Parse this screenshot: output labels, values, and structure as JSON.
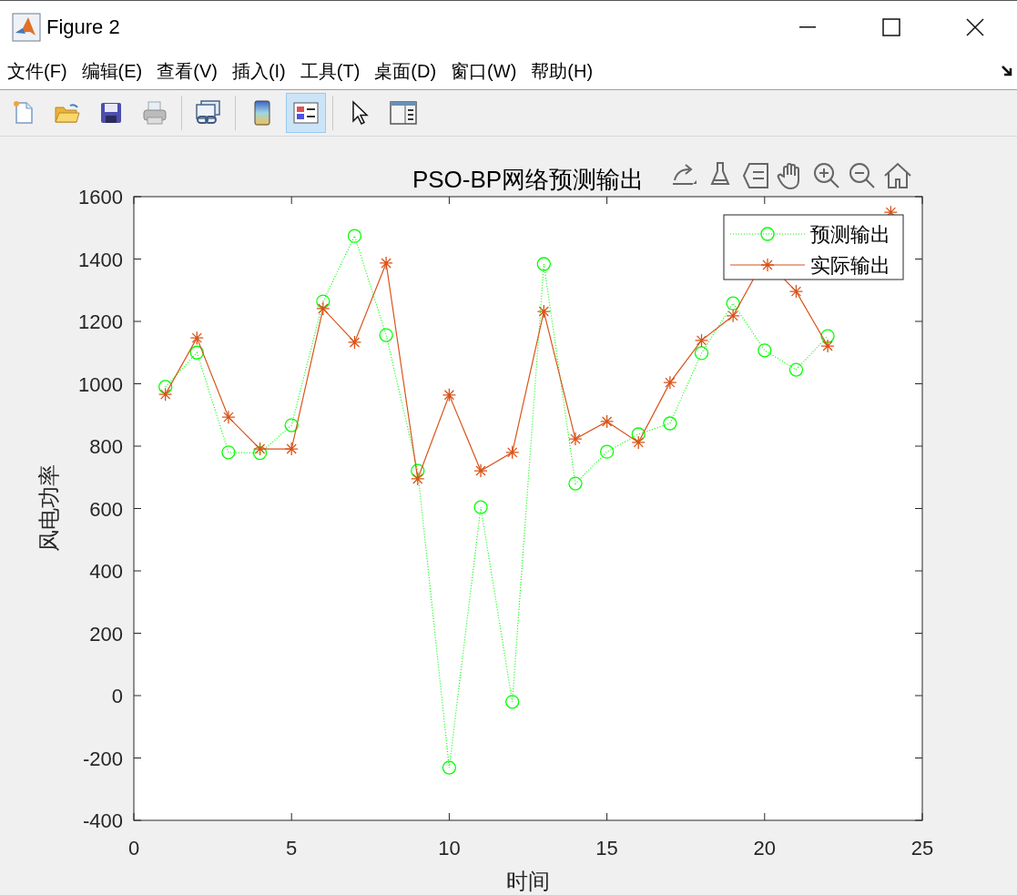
{
  "window": {
    "title": "Figure 2"
  },
  "menu": [
    {
      "label": "文件(F)"
    },
    {
      "label": "编辑(E)"
    },
    {
      "label": "查看(V)"
    },
    {
      "label": "插入(I)"
    },
    {
      "label": "工具(T)"
    },
    {
      "label": "桌面(D)"
    },
    {
      "label": "窗口(W)"
    },
    {
      "label": "帮助(H)"
    }
  ],
  "toolbar": [
    {
      "kind": "new",
      "selected": false
    },
    {
      "kind": "open",
      "selected": false
    },
    {
      "kind": "save",
      "selected": false
    },
    {
      "kind": "print",
      "selected": false
    },
    {
      "kind": "link",
      "selected": false
    },
    {
      "kind": "colorbar",
      "selected": false
    },
    {
      "kind": "legend",
      "selected": true
    },
    {
      "kind": "pointer",
      "selected": false
    },
    {
      "kind": "property",
      "selected": false
    }
  ],
  "axes_toolbar": [
    {
      "kind": "brush-export"
    },
    {
      "kind": "brush"
    },
    {
      "kind": "datatip"
    },
    {
      "kind": "pan"
    },
    {
      "kind": "zoom-in"
    },
    {
      "kind": "zoom-out"
    },
    {
      "kind": "home"
    }
  ],
  "chart_data": {
    "type": "line",
    "title": "PSO-BP网络预测输出",
    "xlabel": "时间",
    "ylabel": "风电功率",
    "x": [
      1,
      2,
      3,
      4,
      5,
      6,
      7,
      8,
      9,
      10,
      11,
      12,
      13,
      14,
      15,
      16,
      17,
      18,
      19,
      20,
      21,
      22,
      23,
      24
    ],
    "series": [
      {
        "name": "预测输出",
        "color": "#00ff00",
        "marker": "circle",
        "line_style": "dotted",
        "values": [
          990,
          1100,
          780,
          778,
          867,
          1264,
          1474,
          1156,
          721,
          -231,
          604,
          -20,
          1384,
          680,
          782,
          838,
          873,
          1098,
          1258,
          1107,
          1045,
          1153,
          null,
          null
        ]
      },
      {
        "name": "实际输出",
        "color": "#d95319",
        "marker": "cross",
        "line_style": "solid",
        "values": [
          966,
          1147,
          893,
          791,
          791,
          1241,
          1133,
          1387,
          695,
          964,
          721,
          780,
          1232,
          823,
          879,
          812,
          1004,
          1139,
          1218,
          1400,
          1296,
          1121,
          null,
          1550
        ]
      }
    ],
    "legend": true,
    "xlim": [
      0,
      25
    ],
    "ylim": [
      -400,
      1600
    ],
    "xticks": [
      0,
      5,
      10,
      15,
      20,
      25
    ],
    "yticks": [
      -400,
      -200,
      0,
      200,
      400,
      600,
      800,
      1000,
      1200,
      1400,
      1600
    ]
  }
}
